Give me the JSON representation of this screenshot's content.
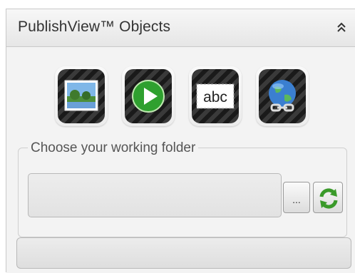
{
  "panel": {
    "title": "PublishView™ Objects",
    "collapse_icon": "double-chevron-up-icon"
  },
  "objects": [
    {
      "name": "image",
      "icon": "image-icon"
    },
    {
      "name": "video",
      "icon": "play-icon"
    },
    {
      "name": "text",
      "icon": "text-box-icon",
      "label": "abc"
    },
    {
      "name": "hyperlink",
      "icon": "globe-link-icon"
    }
  ],
  "folder": {
    "legend": "Choose your working folder",
    "value": "",
    "browse_label": "...",
    "refresh_icon": "refresh-icon"
  },
  "status": {
    "text": ""
  },
  "colors": {
    "header_text": "#333333",
    "legend_text": "#555555",
    "refresh_green": "#3a9a2a",
    "play_green": "#2fa02f"
  }
}
